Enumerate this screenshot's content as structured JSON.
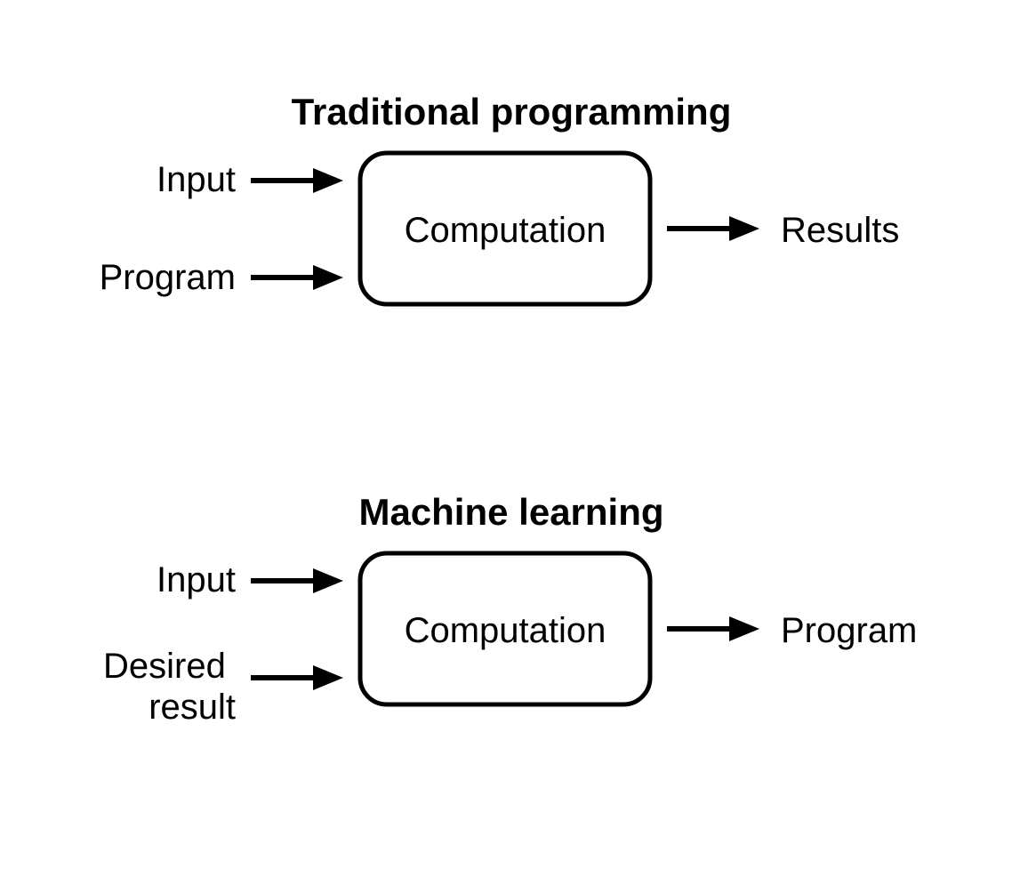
{
  "diagrams": [
    {
      "title": "Traditional programming",
      "inputs": [
        "Input",
        "Program"
      ],
      "process": "Computation",
      "output": "Results"
    },
    {
      "title": "Machine learning",
      "inputs": [
        "Input",
        "Desired\nresult"
      ],
      "process": "Computation",
      "output": "Program"
    }
  ]
}
